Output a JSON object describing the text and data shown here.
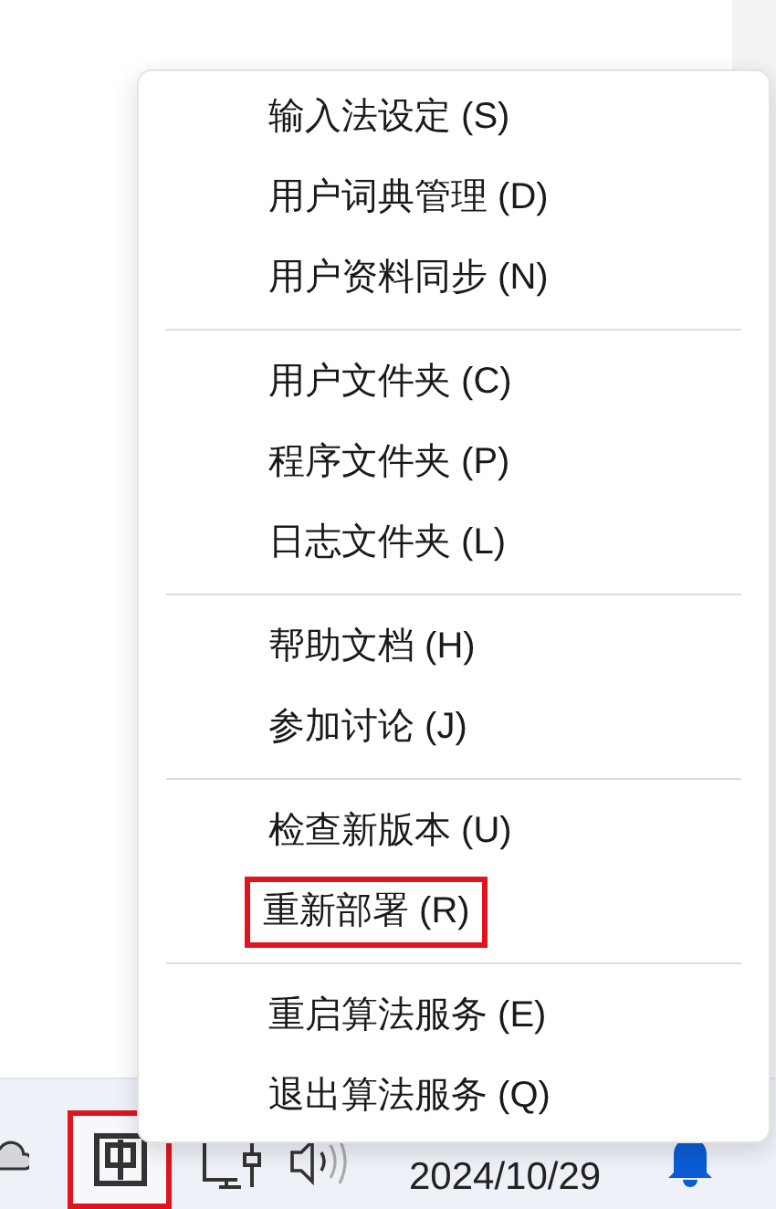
{
  "menu": {
    "groups": [
      {
        "items": [
          {
            "label": "输入法设定 (S)",
            "highlighted": false
          },
          {
            "label": "用户词典管理 (D)",
            "highlighted": false
          },
          {
            "label": "用户资料同步 (N)",
            "highlighted": false
          }
        ]
      },
      {
        "items": [
          {
            "label": "用户文件夹 (C)",
            "highlighted": false
          },
          {
            "label": "程序文件夹 (P)",
            "highlighted": false
          },
          {
            "label": "日志文件夹 (L)",
            "highlighted": false
          }
        ]
      },
      {
        "items": [
          {
            "label": "帮助文档 (H)",
            "highlighted": false
          },
          {
            "label": "参加讨论 (J)",
            "highlighted": false
          }
        ]
      },
      {
        "items": [
          {
            "label": "检查新版本 (U)",
            "highlighted": false
          },
          {
            "label": "重新部署 (R)",
            "highlighted": true
          }
        ]
      },
      {
        "items": [
          {
            "label": "重启算法服务 (E)",
            "highlighted": false
          },
          {
            "label": "退出算法服务 (Q)",
            "highlighted": false
          }
        ]
      }
    ]
  },
  "taskbar": {
    "ime_icon": {
      "highlighted": true
    },
    "date": "2024/10/29"
  }
}
